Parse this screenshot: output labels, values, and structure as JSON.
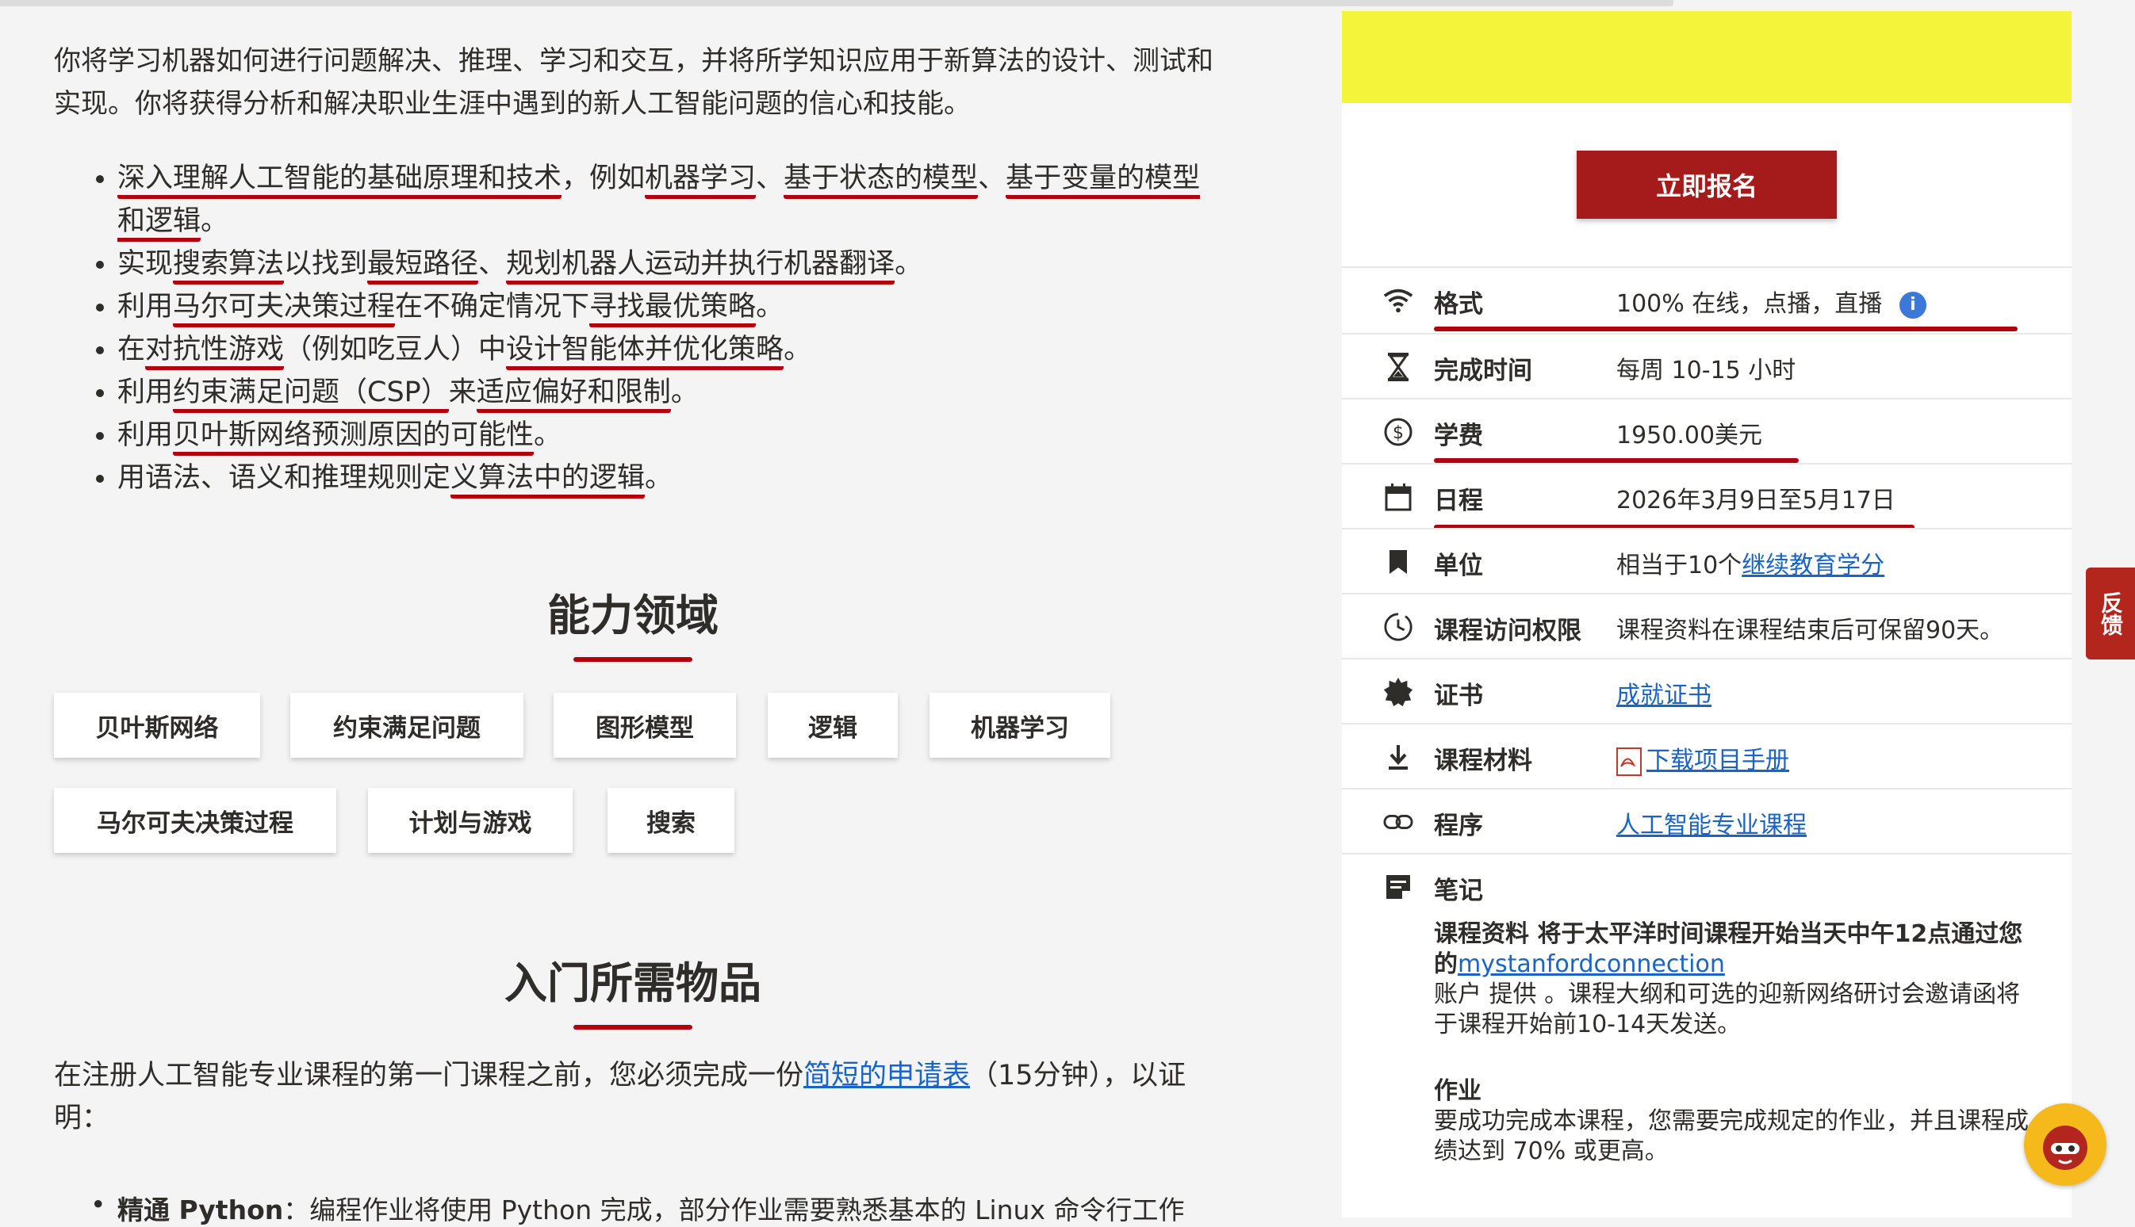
{
  "intro": {
    "text": "你将学习机器如何进行问题解决、推理、学习和交互，并将所学知识应用于新算法的设计、测试和实现。你将获得分析和解决职业生涯中遇到的新人工智能问题的信心和技能。"
  },
  "objectives": [
    {
      "parts": [
        "深入理解人工智能的基础原理和技术",
        "，例如",
        "机器学习",
        "、",
        "基于状态的模型",
        "、",
        "基于变量的模型和逻辑",
        "。"
      ]
    },
    {
      "parts": [
        "实现",
        "搜索算法",
        "以找到",
        "最短路径",
        "、",
        "规划机器人运动并执行机器翻译",
        "。"
      ]
    },
    {
      "parts": [
        "利用",
        "马尔可夫决策过程",
        "在不确定情况下",
        "寻找最优策略",
        "。"
      ]
    },
    {
      "parts": [
        "在",
        "对抗性游戏",
        "（例如吃豆人）中",
        "设计智能体并优化策略",
        "。"
      ]
    },
    {
      "parts": [
        "利用",
        "约束满足问题（CSP）",
        "来",
        "适应偏好和限制",
        "。"
      ]
    },
    {
      "parts": [
        "利用",
        "贝叶斯网络预测原因的可能性",
        "。"
      ]
    },
    {
      "parts": [
        "用语法、语义和推理规则定",
        "义算法中的逻辑",
        "。"
      ]
    }
  ],
  "competencies": {
    "title": "能力领域",
    "chips": [
      "贝叶斯网络",
      "约束满足问题",
      "图形模型",
      "逻辑",
      "机器学习",
      "马尔可夫决策过程",
      "计划与游戏",
      "搜索"
    ]
  },
  "prerequisites": {
    "title": "入门所需物品",
    "text_before": "在注册人工智能专业课程的第一门课程之前，您必须完成一份",
    "link": "简短的申请表",
    "text_after": "（15分钟），以证明：",
    "bullet_bold": "精通 Python",
    "bullet_text": "：编程作业将使用 Python 完成，部分作业需要熟悉基本的 Linux 命令行工作"
  },
  "panel": {
    "enroll_button": "立即报名",
    "rows": [
      {
        "label": "格式",
        "value": "100% 在线，点播，直播",
        "icon": "wifi-icon"
      },
      {
        "label": "完成时间",
        "value": "每周 10-15 小时",
        "icon": "hourglass-icon"
      },
      {
        "label": "学费",
        "value": "1950.00美元",
        "icon": "dollar-icon"
      },
      {
        "label": "日程",
        "value": "2026年3月9日至5月17日",
        "icon": "calendar-icon"
      },
      {
        "label": "单位",
        "value_prefix": "相当于10个",
        "value_link": "继续教育学分",
        "icon": "bookmark-icon"
      },
      {
        "label": "课程访问权限",
        "value": "课程资料在课程结束后可保留90天。",
        "icon": "clock-access-icon"
      },
      {
        "label": "证书",
        "value_link": "成就证书",
        "icon": "badge-icon"
      },
      {
        "label": "课程材料",
        "value_link": "下载项目手册",
        "icon": "download-icon"
      },
      {
        "label": "程序",
        "value_link": "人工智能专业课程",
        "icon": "link-icon"
      }
    ],
    "notes": {
      "label": "笔记",
      "bold_text": "课程资料 将于太平洋时间课程开始当天中午12点通过您的",
      "link": "mystanfordconnection",
      "text": "账户 提供 。课程大纲和可选的迎新网络研讨会邀请函将于课程开始前10-14天发送。",
      "homework_title": "作业",
      "homework_text": "要成功完成本课程，您需要完成规定的作业，并且课程成绩达到 70% 或更高。"
    }
  },
  "feedback_tab": "反馈",
  "colors": {
    "accent": "#b1040e",
    "button": "#a51b1b",
    "link": "#1a64c8",
    "banner": "#f4f43a"
  }
}
